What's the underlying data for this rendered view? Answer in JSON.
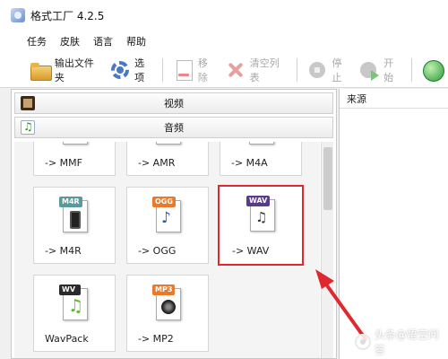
{
  "window": {
    "title": "格式工厂 4.2.5"
  },
  "menu": [
    "任务",
    "皮肤",
    "语言",
    "帮助"
  ],
  "toolbar": {
    "output_folder": "输出文件夹",
    "options": "选项",
    "remove": "移除",
    "clear_list": "清空列表",
    "stop": "停止",
    "start": "开始"
  },
  "categories": {
    "video": "视频",
    "audio": "音频"
  },
  "tiles": {
    "mmf": {
      "label": "-> MMF"
    },
    "amr": {
      "label": "-> AMR"
    },
    "m4a": {
      "label": "-> M4A"
    },
    "m4r": {
      "label": "-> M4R",
      "tag": "M4R",
      "tag_color": "#5a9a9a"
    },
    "ogg": {
      "label": "-> OGG",
      "tag": "OGG",
      "tag_color": "#e87a2a"
    },
    "wav": {
      "label": "-> WAV",
      "tag": "WAV",
      "tag_color": "#5a3a8a"
    },
    "wavpack": {
      "label": "WavPack",
      "tag": "WV",
      "tag_color": "#2a2a2a"
    },
    "mp2": {
      "label": "-> MP2",
      "tag": "MP3",
      "tag_color": "#e87a2a"
    }
  },
  "right_panel": {
    "header": "来源"
  },
  "watermark": "头条@悟空问答",
  "colors": {
    "highlight": "#e0282f",
    "arrow": "#e0282f"
  }
}
